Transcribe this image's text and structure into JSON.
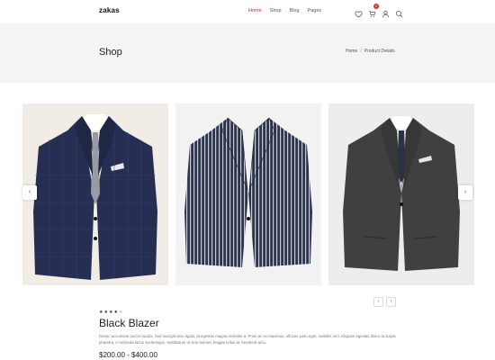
{
  "header": {
    "logo": "zakas",
    "nav": [
      {
        "label": "Home",
        "active": true
      },
      {
        "label": "Shop",
        "active": false
      },
      {
        "label": "Blog",
        "active": false
      },
      {
        "label": "Pages",
        "active": false
      }
    ],
    "icons": [
      "heart-icon",
      "cart-icon",
      "user-icon",
      "search-icon"
    ],
    "cart_count": "0"
  },
  "title_band": {
    "title": "Shop",
    "breadcrumb": {
      "home": "Home",
      "separator": "/",
      "current": "Product Details"
    }
  },
  "gallery": {
    "prev_arrow": "‹",
    "next_arrow": "›",
    "images": [
      {
        "alt": "Navy checked blazer with pocket square",
        "jacket_color": "#262f52"
      },
      {
        "alt": "Navy and white pinstripe blazer",
        "jacket_color": "#2c3448"
      },
      {
        "alt": "Charcoal grey blazer with tie",
        "jacket_color": "#414040"
      }
    ],
    "thumb_prev": "‹",
    "thumb_next": "›"
  },
  "product": {
    "rating": 4,
    "max_rating": 5,
    "name": "Black Blazer",
    "description": "Donec accumsan auctor iaculis. Sed suscipit arcu ligula, at egestas magna molestie a. Proin ac ex maximus, ultrices justo eget, sodales orci. Aliquam egestas libero ac turpis pharetra, in vehicula lacus scelerisque. Vestibulum ut sem laoreet, feugiat tellus at, hendrerit arcu.",
    "price": "$200.00 - $400.00"
  },
  "colors": {
    "accent": "#d0312d",
    "band_bg": "#f4f4f4"
  }
}
